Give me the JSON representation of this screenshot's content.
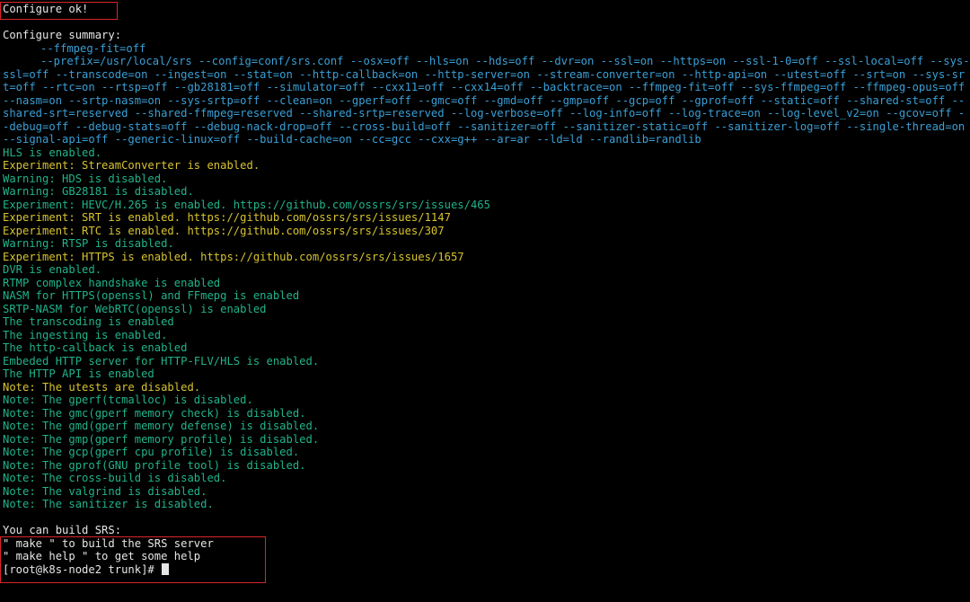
{
  "colors": {
    "background": "#000000",
    "default_text": "#e6e6e6",
    "option_cyan": "#3a9fd6",
    "enabled_green": "#21b38a",
    "experiment_yellow": "#d7c330",
    "highlight_box": "#d9262b"
  },
  "terminal": {
    "configure_ok": "Configure ok!",
    "summary_title": "Configure summary:",
    "summary_line1": "--ffmpeg-fit=off",
    "summary_line2": "--prefix=/usr/local/srs --config=conf/srs.conf --osx=off --hls=on --hds=off --dvr=on --ssl=on --https=on --ssl-1-0=off --ssl-local=off --sys-ssl=off --transcode=on --ingest=on --stat=on --http-callback=on --http-server=on --stream-converter=on --http-api=on --utest=off --srt=on --sys-srt=off --rtc=on --rtsp=off --gb28181=off --simulator=off --cxx11=off --cxx14=off --backtrace=on --ffmpeg-fit=off --sys-ffmpeg=off --ffmpeg-opus=off --nasm=on --srtp-nasm=on --sys-srtp=off --clean=on --gperf=off --gmc=off --gmd=off --gmp=off --gcp=off --gprof=off --static=off --shared-st=off --shared-srt=reserved --shared-ffmpeg=reserved --shared-srtp=reserved --log-verbose=off --log-info=off --log-trace=on --log-level_v2=on --gcov=off --debug=off --debug-stats=off --debug-nack-drop=off --cross-build=off --sanitizer=off --sanitizer-static=off --sanitizer-log=off --single-thread=on --signal-api=off --generic-linux=off --build-cache=on --cc=gcc --cxx=g++ --ar=ar --ld=ld --randlib=randlib",
    "status_lines": [
      {
        "text": "HLS is enabled.",
        "color": "green"
      },
      {
        "text": "Experiment: StreamConverter is enabled.",
        "color": "yellow"
      },
      {
        "text": "Warning: HDS is disabled.",
        "color": "green"
      },
      {
        "text": "Warning: GB28181 is disabled.",
        "color": "green"
      },
      {
        "text": "Experiment: HEVC/H.265 is enabled. https://github.com/ossrs/srs/issues/465",
        "color": "green"
      },
      {
        "text": "Experiment: SRT is enabled. https://github.com/ossrs/srs/issues/1147",
        "color": "yellow"
      },
      {
        "text": "Experiment: RTC is enabled. https://github.com/ossrs/srs/issues/307",
        "color": "yellow"
      },
      {
        "text": "Warning: RTSP is disabled.",
        "color": "green"
      },
      {
        "text": "Experiment: HTTPS is enabled. https://github.com/ossrs/srs/issues/1657",
        "color": "yellow"
      },
      {
        "text": "DVR is enabled.",
        "color": "green"
      },
      {
        "text": "RTMP complex handshake is enabled",
        "color": "green"
      },
      {
        "text": "NASM for HTTPS(openssl) and FFmepg is enabled",
        "color": "green"
      },
      {
        "text": "SRTP-NASM for WebRTC(openssl) is enabled",
        "color": "green"
      },
      {
        "text": "The transcoding is enabled",
        "color": "green"
      },
      {
        "text": "The ingesting is enabled.",
        "color": "green"
      },
      {
        "text": "The http-callback is enabled",
        "color": "green"
      },
      {
        "text": "Embeded HTTP server for HTTP-FLV/HLS is enabled.",
        "color": "green"
      },
      {
        "text": "The HTTP API is enabled",
        "color": "green"
      },
      {
        "text": "Note: The utests are disabled.",
        "color": "yellow"
      },
      {
        "text": "Note: The gperf(tcmalloc) is disabled.",
        "color": "green"
      },
      {
        "text": "Note: The gmc(gperf memory check) is disabled.",
        "color": "green"
      },
      {
        "text": "Note: The gmd(gperf memory defense) is disabled.",
        "color": "green"
      },
      {
        "text": "Note: The gmp(gperf memory profile) is disabled.",
        "color": "green"
      },
      {
        "text": "Note: The gcp(gperf cpu profile) is disabled.",
        "color": "green"
      },
      {
        "text": "Note: The gprof(GNU profile tool) is disabled.",
        "color": "green"
      },
      {
        "text": "Note: The cross-build is disabled.",
        "color": "green"
      },
      {
        "text": "Note: The valgrind is disabled.",
        "color": "green"
      },
      {
        "text": "Note: The sanitizer is disabled.",
        "color": "green"
      }
    ],
    "build_hint_title": "You can build SRS:",
    "build_hint_line1": "\" make \" to build the SRS server",
    "build_hint_line2": "\" make help \" to get some help",
    "prompt": "[root@k8s-node2 trunk]# "
  }
}
